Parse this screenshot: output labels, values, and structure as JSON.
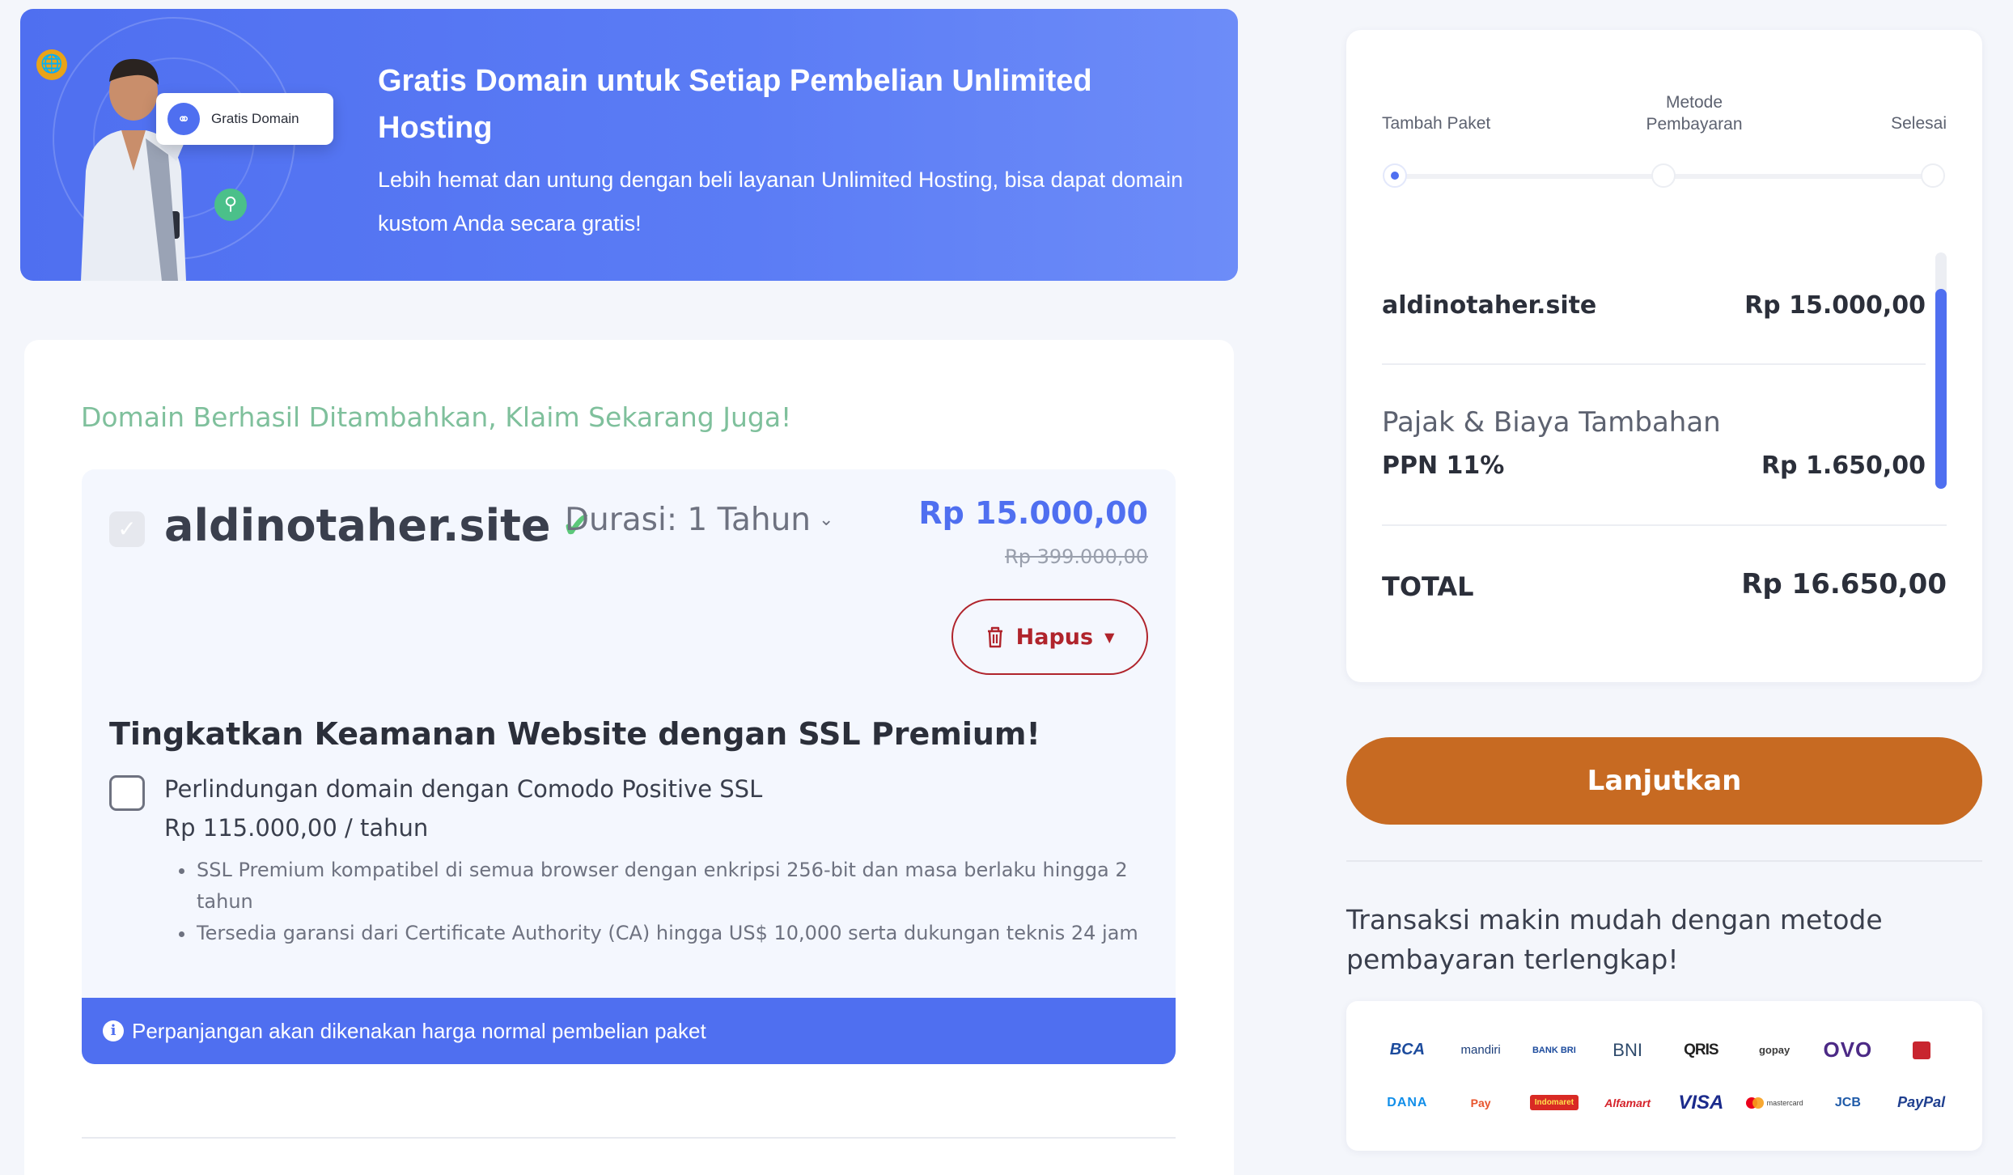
{
  "banner": {
    "chip_label": "Gratis Domain",
    "title": "Gratis Domain untuk Setiap Pembelian Unlimited Hosting",
    "subtitle": "Lebih hemat dan untung dengan beli layanan Unlimited Hosting, bisa dapat domain kustom Anda secara gratis!"
  },
  "cart": {
    "success_message": "Domain Berhasil Ditambahkan, Klaim Sekarang Juga!",
    "domain": "aldinotaher.site",
    "duration_label": "Durasi: 1 Tahun",
    "price": "Rp 15.000,00",
    "price_original": "Rp 399.000,00",
    "delete_label": "Hapus",
    "ssl": {
      "title": "Tingkatkan Keamanan Website dengan SSL Premium!",
      "option_label": "Perlindungan domain dengan Comodo Positive SSL",
      "option_price": "Rp 115.000,00 / tahun",
      "checked": false,
      "features": [
        "SSL Premium kompatibel di semua browser dengan enkripsi 256-bit dan masa berlaku hingga 2 tahun",
        "Tersedia garansi dari Certificate Authority (CA) hingga US$ 10,000 serta dukungan teknis 24 jam"
      ]
    },
    "renewal_notice": "Perpanjangan akan dikenakan harga normal pembelian paket"
  },
  "checkout_steps": {
    "current": 1,
    "steps": [
      "Tambah Paket",
      "Metode Pembayaran",
      "Selesai"
    ],
    "step2_line1": "Metode",
    "step2_line2": "Pembayaran"
  },
  "summary": {
    "item_name": "aldinotaher.site",
    "item_price": "Rp 15.000,00",
    "tax_section_title": "Pajak & Biaya Tambahan",
    "tax_name": "PPN 11%",
    "tax_price": "Rp 1.650,00",
    "total_label": "TOTAL",
    "total_price": "Rp 16.650,00"
  },
  "cta": {
    "label": "Lanjutkan"
  },
  "payments": {
    "headline": "Transaksi makin mudah dengan metode pembayaran terlengkap!",
    "methods": {
      "bca": "BCA",
      "mandiri": "mandiri",
      "bri": "BANK BRI",
      "bni": "BNI",
      "qris": "QRIS",
      "gopay": "gopay",
      "ovo": "OVO",
      "dana": "DANA",
      "shopeepay": "Pay",
      "indomaret": "Indomaret",
      "alfamart": "Alfamart",
      "visa": "VISA",
      "mastercard": "mastercard",
      "jcb": "JCB",
      "paypal": "PayPal"
    }
  },
  "colors": {
    "primary": "#4f6ff0",
    "success_text": "#7fc09c",
    "danger": "#b0242c",
    "cta": "#c76a22",
    "check_green": "#5cc87a"
  }
}
